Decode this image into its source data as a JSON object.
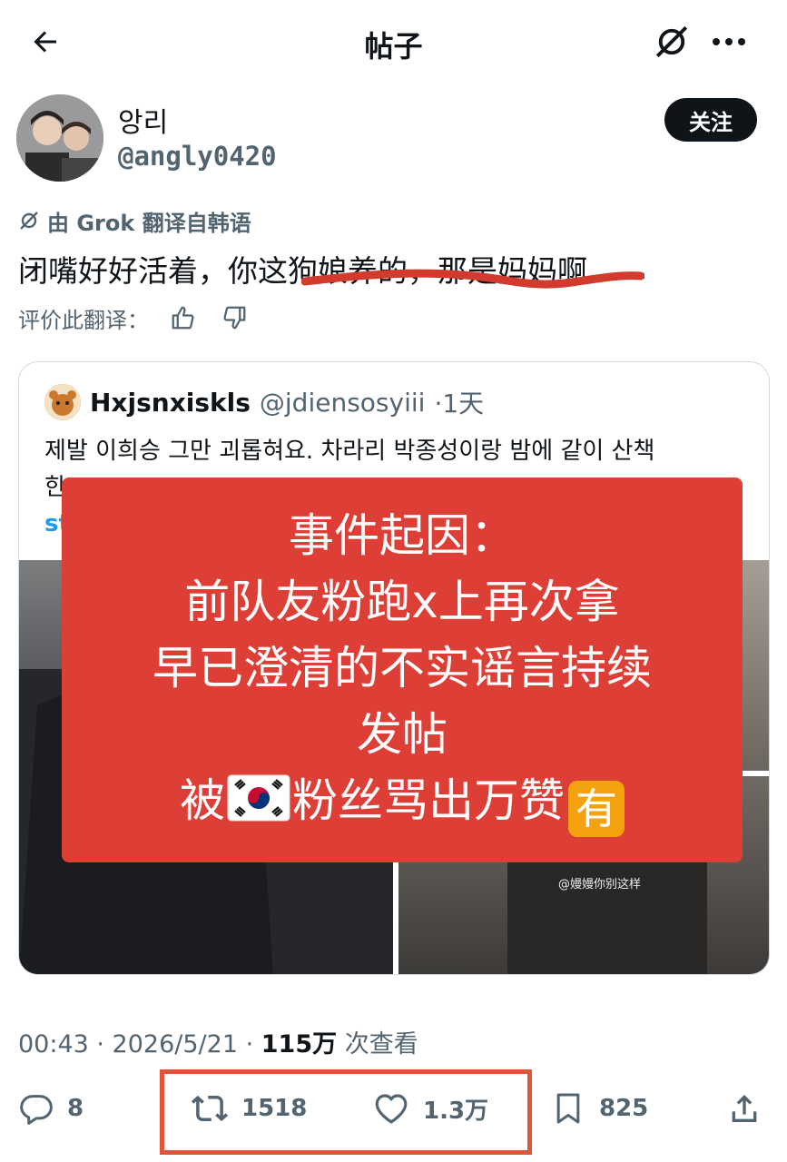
{
  "header": {
    "title": "帖子"
  },
  "author": {
    "name": "앙리",
    "handle": "@angly0420",
    "follow_label": "关注"
  },
  "translation": {
    "note": "由 Grok 翻译自韩语",
    "text": "闭嘴好好活着，你这狗娘养的，那是妈妈啊",
    "rate_label": "评价此翻译："
  },
  "quote": {
    "name": "Hxjsnxiskls",
    "handle": "@jdiensosyiii",
    "time": "·1天",
    "text_line1": "제발 이희승 그만 괴롭혀요. 차라리 박종성이랑 밤에 같이 산책",
    "text_line2": "한",
    "text_line3": "st",
    "watermark": "@嫚嫚你别这样"
  },
  "overlay": {
    "line1": "事件起因：",
    "line2": "前队友粉跑x上再次拿",
    "line3": "早已澄清的不实谣言持续",
    "line4": "发帖",
    "line5_a": "被",
    "line5_b": "粉丝骂出万赞",
    "badge": "有"
  },
  "meta": {
    "time": "00:43 · 2026/5/21 · ",
    "views": "115万",
    "views_suffix": " 次查看"
  },
  "actions": {
    "replies": "8",
    "reposts": "1518",
    "likes": "1.3万",
    "bookmarks": "825"
  },
  "colors": {
    "overlay": "#dd3e36",
    "highlight": "#e0553a",
    "text": "#0f1419",
    "muted": "#536471"
  }
}
